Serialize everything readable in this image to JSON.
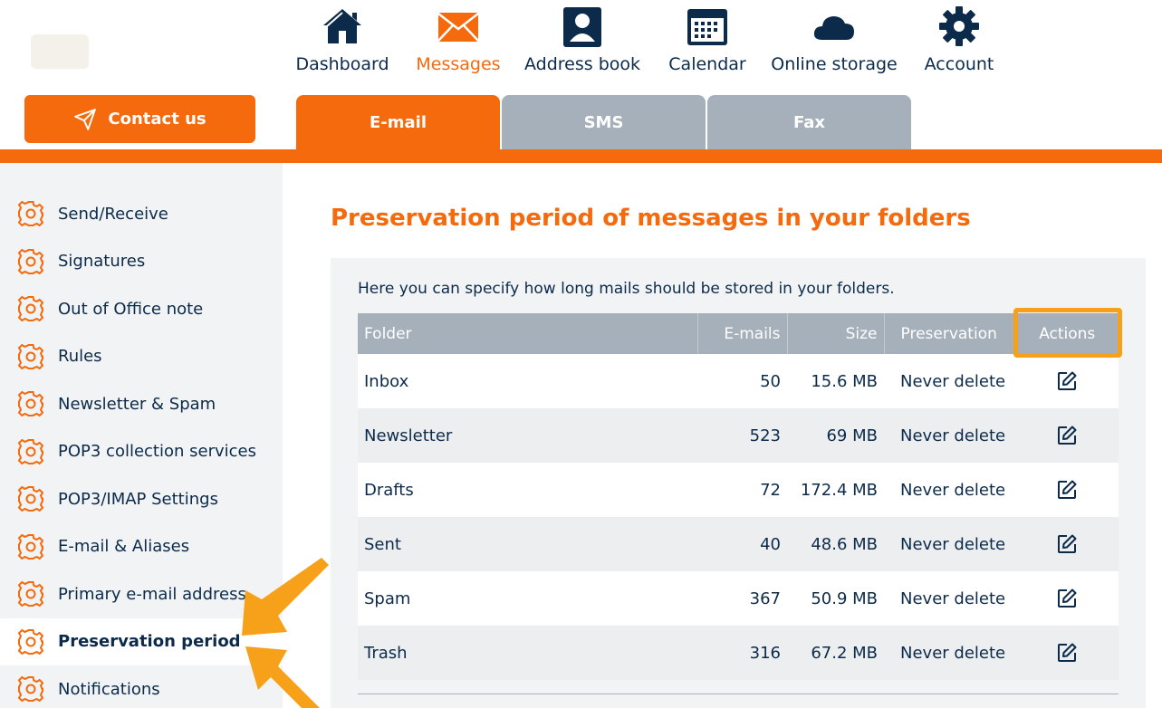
{
  "colors": {
    "accent": "#f46a0c",
    "navy": "#0c2b4b",
    "tab_inactive": "#a6b0bb",
    "highlight": "#f7a11a"
  },
  "header": {
    "contact_button": "Contact us",
    "nav": [
      {
        "label": "Dashboard",
        "icon": "home-icon"
      },
      {
        "label": "Messages",
        "icon": "envelope-icon"
      },
      {
        "label": "Address book",
        "icon": "contact-card-icon"
      },
      {
        "label": "Calendar",
        "icon": "calendar-icon"
      },
      {
        "label": "Online storage",
        "icon": "cloud-icon"
      },
      {
        "label": "Account",
        "icon": "gear-icon"
      }
    ],
    "active_nav": "Messages",
    "sub_tabs": [
      "E-mail",
      "SMS",
      "Fax"
    ],
    "active_sub_tab": "E-mail"
  },
  "sidebar": {
    "items": [
      {
        "label": "Send/Receive"
      },
      {
        "label": "Signatures"
      },
      {
        "label": "Out of Office note"
      },
      {
        "label": "Rules"
      },
      {
        "label": "Newsletter & Spam"
      },
      {
        "label": "POP3 collection services"
      },
      {
        "label": "POP3/IMAP Settings"
      },
      {
        "label": "E-mail & Aliases"
      },
      {
        "label": "Primary e-mail address"
      },
      {
        "label": "Preservation period"
      },
      {
        "label": "Notifications"
      }
    ],
    "active_item": "Preservation period"
  },
  "main": {
    "title": "Preservation period of messages in your folders",
    "intro": "Here you can specify how long mails should be stored in your folders.",
    "table": {
      "headers": {
        "folder": "Folder",
        "emails": "E-mails",
        "size": "Size",
        "preservation": "Preservation",
        "actions": "Actions"
      },
      "rows": [
        {
          "folder": "Inbox",
          "emails": "50",
          "size": "15.6 MB",
          "preservation": "Never delete"
        },
        {
          "folder": "Newsletter",
          "emails": "523",
          "size": "69 MB",
          "preservation": "Never delete"
        },
        {
          "folder": "Drafts",
          "emails": "72",
          "size": "172.4 MB",
          "preservation": "Never delete"
        },
        {
          "folder": "Sent",
          "emails": "40",
          "size": "48.6 MB",
          "preservation": "Never delete"
        },
        {
          "folder": "Spam",
          "emails": "367",
          "size": "50.9 MB",
          "preservation": "Never delete"
        },
        {
          "folder": "Trash",
          "emails": "316",
          "size": "67.2 MB",
          "preservation": "Never delete"
        }
      ]
    }
  }
}
